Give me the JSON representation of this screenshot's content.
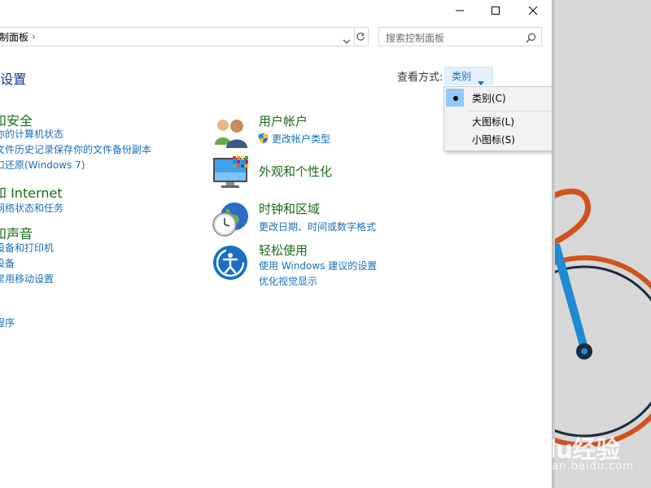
{
  "colors": {
    "title_green": "#1a6b1a",
    "link_blue": "#1a6fb8",
    "heading_navy": "#1e3287",
    "menu_highlight": "#91c9f7",
    "desktop_bg": "#d7d7d7",
    "bike_orange": "#d2521c",
    "bike_blue": "#1e8ad1"
  },
  "window": {
    "caption_buttons": [
      "minimize-icon",
      "maximize-icon",
      "close-icon"
    ]
  },
  "address": {
    "path": "制面板",
    "separator": "›",
    "dropdown_icon": "chevron-down-icon",
    "refresh_icon": "refresh-icon"
  },
  "search": {
    "placeholder": "搜索控制面板",
    "icon": "search-icon"
  },
  "header": {
    "title": "]设置",
    "view_label": "查看方式:",
    "view_value": "类别"
  },
  "view_menu": {
    "items": [
      {
        "label": "类别(C)",
        "selected": true
      },
      {
        "label": "大图标(L)",
        "selected": false
      },
      {
        "label": "小图标(S)",
        "selected": false
      }
    ]
  },
  "left_categories": [
    {
      "title": "和安全",
      "links": [
        "你的计算机状态",
        "文件历史记录保存你的文件备份副本",
        "口还原(Windows 7)"
      ]
    },
    {
      "title": "和 Internet",
      "links": [
        "网络状态和任务"
      ]
    },
    {
      "title": "和声音",
      "links": [
        "设备和打印机",
        "设备",
        "常用移动设置"
      ]
    },
    {
      "title": ":",
      "links": [
        "程序"
      ]
    }
  ],
  "right_categories": [
    {
      "icon": "user-accounts-icon",
      "title": "用户帐户",
      "links": [
        "更改帐户类型"
      ],
      "link_icon": "uac-shield-icon"
    },
    {
      "icon": "appearance-personalization-icon",
      "title": "外观和个性化",
      "links": []
    },
    {
      "icon": "clock-region-icon",
      "title": "时钟和区域",
      "links": [
        "更改日期、时间或数字格式"
      ]
    },
    {
      "icon": "ease-of-access-icon",
      "title": "轻松使用",
      "links": [
        "使用 Windows 建议的设置",
        "优化视觉显示"
      ]
    }
  ],
  "watermark": {
    "logo": "Baidu经验",
    "sub": "jingyan.baidu.com"
  }
}
